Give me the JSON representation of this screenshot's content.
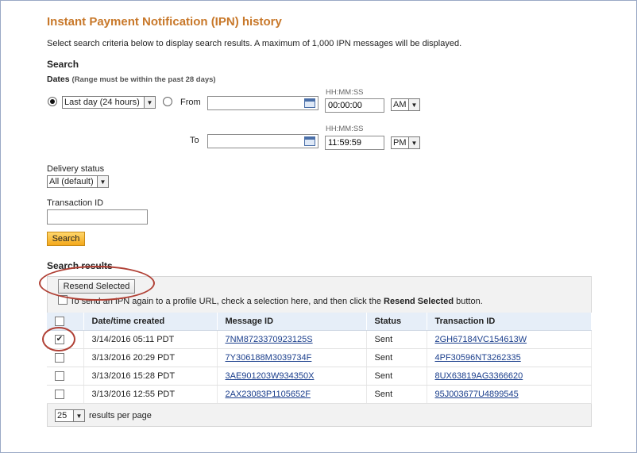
{
  "page": {
    "title": "Instant Payment Notification (IPN) history",
    "description": "Select search criteria below to display search results. A maximum of 1,000 IPN messages will be displayed."
  },
  "search": {
    "heading": "Search",
    "dates_label": "Dates",
    "dates_note": "(Range must be within the past 28 days)",
    "preset_value": "Last day (24 hours)",
    "from_label": "From",
    "to_label": "To",
    "time_format_label": "HH:MM:SS",
    "from_date": "",
    "from_time": "00:00:00",
    "from_ampm": "AM",
    "to_date": "",
    "to_time": "11:59:59",
    "to_ampm": "PM",
    "delivery_status_label": "Delivery status",
    "delivery_status_value": "All (default)",
    "transaction_id_label": "Transaction ID",
    "transaction_id_value": "",
    "search_button": "Search"
  },
  "results": {
    "heading": "Search results",
    "resend_button": "Resend Selected",
    "resend_hint_pre": "To send an IPN again to a profile URL, check a selection here, and then click the ",
    "resend_hint_bold": "Resend Selected",
    "resend_hint_post": " button.",
    "columns": [
      "Date/time created",
      "Message ID",
      "Status",
      "Transaction ID"
    ],
    "rows": [
      {
        "checked": true,
        "date": "3/14/2016 05:11 PDT",
        "message_id": "7NM8723370923125S",
        "status": "Sent",
        "transaction_id": "2GH67184VC154613W"
      },
      {
        "checked": false,
        "date": "3/13/2016 20:29 PDT",
        "message_id": "7Y306188M3039734F",
        "status": "Sent",
        "transaction_id": "4PF30596NT3262335"
      },
      {
        "checked": false,
        "date": "3/13/2016 15:28 PDT",
        "message_id": "3AE901203W934350X",
        "status": "Sent",
        "transaction_id": "8UX63819AG3366620"
      },
      {
        "checked": false,
        "date": "3/13/2016 12:55 PDT",
        "message_id": "2AX23083P1105652F",
        "status": "Sent",
        "transaction_id": "95J003677U4899545"
      }
    ],
    "per_page_value": "25",
    "per_page_label": "results per page"
  },
  "colors": {
    "title": "#c8782a",
    "link": "#1a3e8c",
    "highlight_oval": "#b04035",
    "search_button": "#f4a91c"
  },
  "icons": [
    "radio-selected-icon",
    "radio-unselected-icon",
    "calendar-icon",
    "dropdown-arrow-icon",
    "checkbox-checked-icon",
    "checkbox-unchecked-icon"
  ]
}
